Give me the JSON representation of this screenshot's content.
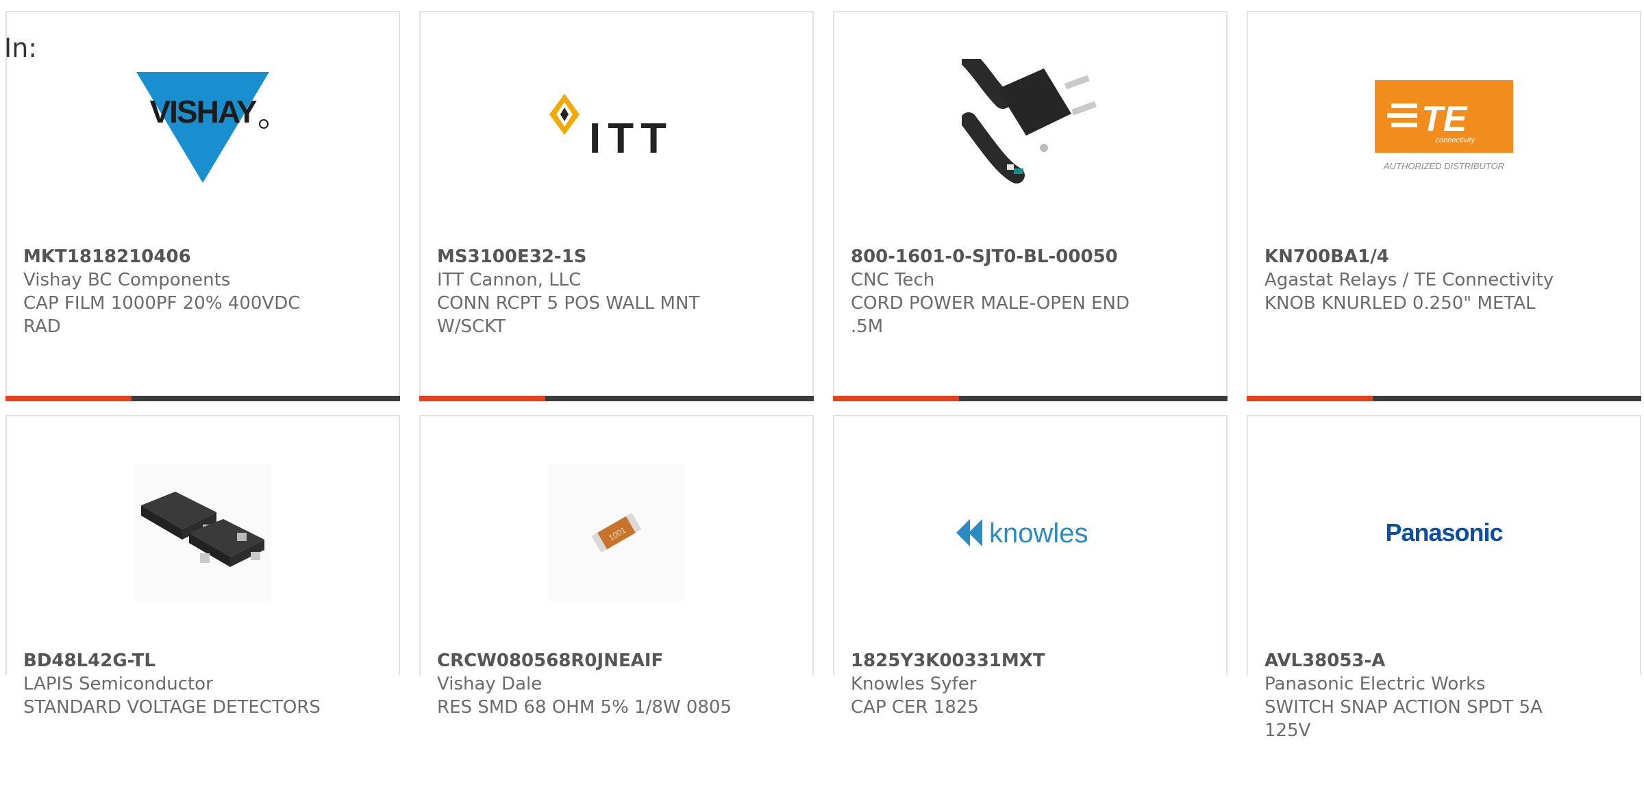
{
  "filter_label": "In:",
  "colors": {
    "accent": "#e8401c",
    "bar_dark": "#3b3b3b",
    "card_border": "#e2e2e2",
    "text": "#6b6b6b"
  },
  "products": [
    {
      "part_number": "MKT1818210406",
      "manufacturer": "Vishay BC Components",
      "description": "CAP FILM 1000PF 20% 400VDC RAD",
      "image_icon": "vishay-logo-icon"
    },
    {
      "part_number": "MS3100E32-1S",
      "manufacturer": "ITT Cannon, LLC",
      "description": "CONN RCPT 5 POS WALL MNT W/SCKT",
      "image_icon": "itt-logo-icon"
    },
    {
      "part_number": "800-1601-0-SJT0-BL-00050",
      "manufacturer": "CNC Tech",
      "description": "CORD POWER MALE-OPEN END .5M",
      "image_icon": "power-cord-icon"
    },
    {
      "part_number": "KN700BA1/4",
      "manufacturer": "Agastat Relays / TE Connectivity",
      "description": "KNOB KNURLED 0.250\" METAL",
      "image_icon": "te-connectivity-logo-icon"
    },
    {
      "part_number": "BD48L42G-TL",
      "manufacturer": "LAPIS Semiconductor",
      "description": "STANDARD VOLTAGE DETECTORS",
      "image_icon": "sot23-chip-icon"
    },
    {
      "part_number": "CRCW080568R0JNEAIF",
      "manufacturer": "Vishay Dale",
      "description": "RES SMD 68 OHM 5% 1/8W 0805",
      "image_icon": "smd-resistor-icon"
    },
    {
      "part_number": "1825Y3K00331MXT",
      "manufacturer": "Knowles Syfer",
      "description": "CAP CER 1825",
      "image_icon": "knowles-logo-icon"
    },
    {
      "part_number": "AVL38053-A",
      "manufacturer": "Panasonic Electric Works",
      "description": "SWITCH SNAP ACTION SPDT 5A 125V",
      "image_icon": "panasonic-logo-icon"
    }
  ],
  "logo_text": {
    "vishay": "VISHAY",
    "itt": "ITT",
    "te": "TE",
    "te_sub": "connectivity",
    "te_auth": "AUTHORIZED DISTRIBUTOR",
    "knowles": "knowles",
    "panasonic": "Panasonic",
    "resistor_mark": "1001"
  }
}
